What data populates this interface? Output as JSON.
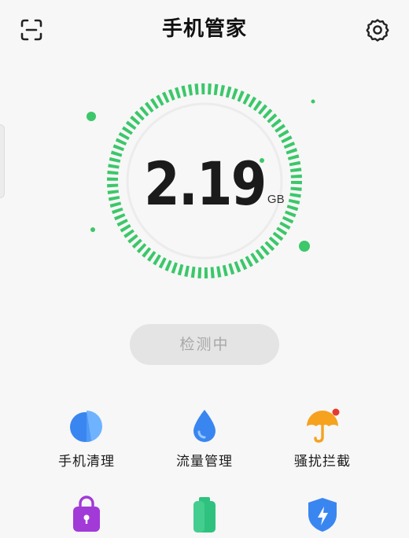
{
  "header": {
    "title": "手机管家",
    "scan_icon": "scan-icon",
    "settings_icon": "gear-icon"
  },
  "gauge": {
    "value": "2.19",
    "unit": "GB",
    "ring_color": "#3cc76a"
  },
  "check_button": {
    "label": "检测中"
  },
  "tools": [
    {
      "label": "手机清理",
      "icon": "pie-clean-icon"
    },
    {
      "label": "流量管理",
      "icon": "water-drop-icon"
    },
    {
      "label": "骚扰拦截",
      "icon": "umbrella-icon"
    },
    {
      "label": "",
      "icon": "lock-bag-icon"
    },
    {
      "label": "",
      "icon": "battery-icon"
    },
    {
      "label": "",
      "icon": "shield-bolt-icon"
    }
  ],
  "colors": {
    "accent": "#3cc76a",
    "blue": "#3a86f0",
    "orange": "#f6a21e",
    "purple": "#a23ad8",
    "badge_red": "#e63a2e"
  }
}
